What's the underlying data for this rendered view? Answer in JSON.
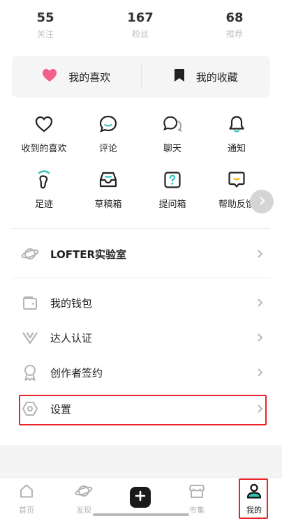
{
  "stats": [
    {
      "value": "55",
      "label": "关注"
    },
    {
      "value": "167",
      "label": "粉丝"
    },
    {
      "value": "68",
      "label": "推荐"
    }
  ],
  "favorites": {
    "likes_label": "我的喜欢",
    "collections_label": "我的收藏",
    "colors": {
      "heart": "#f2608a"
    }
  },
  "grid": [
    {
      "label": "收到的喜欢",
      "icon": "heart-outline-icon"
    },
    {
      "label": "评论",
      "icon": "comment-icon"
    },
    {
      "label": "聊天",
      "icon": "chat-icon"
    },
    {
      "label": "通知",
      "icon": "bell-icon"
    },
    {
      "label": "足迹",
      "icon": "footprint-icon"
    },
    {
      "label": "草稿箱",
      "icon": "drafts-icon"
    },
    {
      "label": "提问箱",
      "icon": "question-box-icon"
    },
    {
      "label": "帮助反馈",
      "icon": "help-feedback-icon"
    }
  ],
  "list": [
    {
      "label": "LOFTER实验室",
      "icon": "planet-icon"
    },
    {
      "label": "我的钱包",
      "icon": "wallet-icon"
    },
    {
      "label": "达人认证",
      "icon": "verified-v-icon"
    },
    {
      "label": "创作者签约",
      "icon": "badge-icon"
    },
    {
      "label": "设置",
      "icon": "settings-hexagon-icon"
    }
  ],
  "nav": [
    {
      "label": "首页",
      "icon": "home-icon"
    },
    {
      "label": "发现",
      "icon": "planet-icon"
    },
    {
      "label": "市集",
      "icon": "store-icon"
    },
    {
      "label": "我的",
      "icon": "profile-icon"
    }
  ],
  "colors": {
    "accent": "#2ec4b6",
    "highlight": "#e8242a"
  }
}
